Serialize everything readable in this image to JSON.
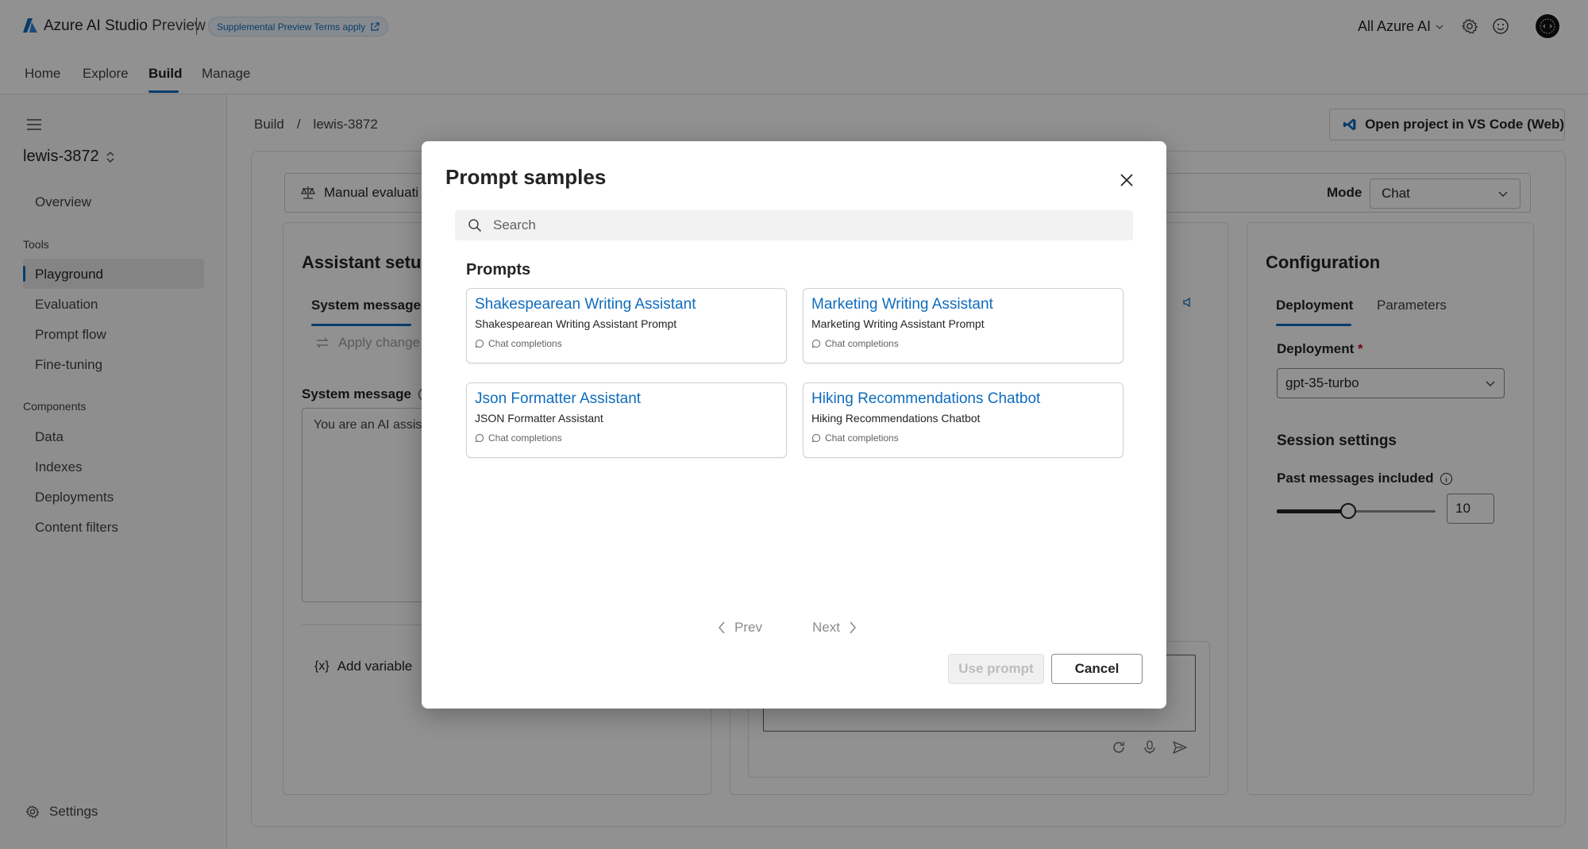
{
  "app": {
    "name": "Azure AI Studio",
    "name_suffix": "Preview",
    "terms_label": "Supplemental Preview Terms apply",
    "scope_label": "All Azure AI"
  },
  "nav": {
    "tabs": [
      "Home",
      "Explore",
      "Build",
      "Manage"
    ],
    "active": "Build"
  },
  "sidebar": {
    "project": "lewis-3872",
    "top_items": [
      "Overview"
    ],
    "tools_heading": "Tools",
    "tools": [
      "Playground",
      "Evaluation",
      "Prompt flow",
      "Fine-tuning"
    ],
    "active_item": "Playground",
    "components_heading": "Components",
    "components": [
      "Data",
      "Indexes",
      "Deployments",
      "Content filters"
    ],
    "settings_label": "Settings"
  },
  "breadcrumb": [
    "Build",
    "/",
    "lewis-3872"
  ],
  "vscode_button": "Open project in VS Code (Web)",
  "toolbar": {
    "manual_eval": "Manual evaluati",
    "mode_label": "Mode",
    "mode_value": "Chat"
  },
  "assistant_setup": {
    "title": "Assistant setup",
    "tab": "System message",
    "apply_changes": "Apply change",
    "system_message_label": "System message",
    "system_message_value": "You are an AI assis",
    "add_variable": "Add variable"
  },
  "configuration": {
    "title": "Configuration",
    "tabs": [
      "Deployment",
      "Parameters"
    ],
    "active_tab": "Deployment",
    "deployment_label": "Deployment",
    "required_mark": "*",
    "deployment_value": "gpt-35-turbo",
    "session_settings": "Session settings",
    "past_messages_label": "Past messages included",
    "past_messages_value": "10",
    "past_messages_slider_fraction": 0.45
  },
  "modal": {
    "title": "Prompt samples",
    "search_placeholder": "Search",
    "section_heading": "Prompts",
    "prompts": [
      {
        "title": "Shakespearean Writing Assistant",
        "subtitle": "Shakespearean Writing Assistant Prompt",
        "type": "Chat completions"
      },
      {
        "title": "Marketing Writing Assistant",
        "subtitle": "Marketing Writing Assistant Prompt",
        "type": "Chat completions"
      },
      {
        "title": "Json Formatter Assistant",
        "subtitle": "JSON Formatter Assistant",
        "type": "Chat completions"
      },
      {
        "title": "Hiking Recommendations Chatbot",
        "subtitle": "Hiking Recommendations Chatbot",
        "type": "Chat completions"
      }
    ],
    "prev_label": "Prev",
    "next_label": "Next",
    "use_prompt_label": "Use prompt",
    "cancel_label": "Cancel"
  },
  "colors": {
    "accent": "#0f6cbd",
    "text": "#242424",
    "overlay": "rgba(0,0,0,0.43)"
  }
}
